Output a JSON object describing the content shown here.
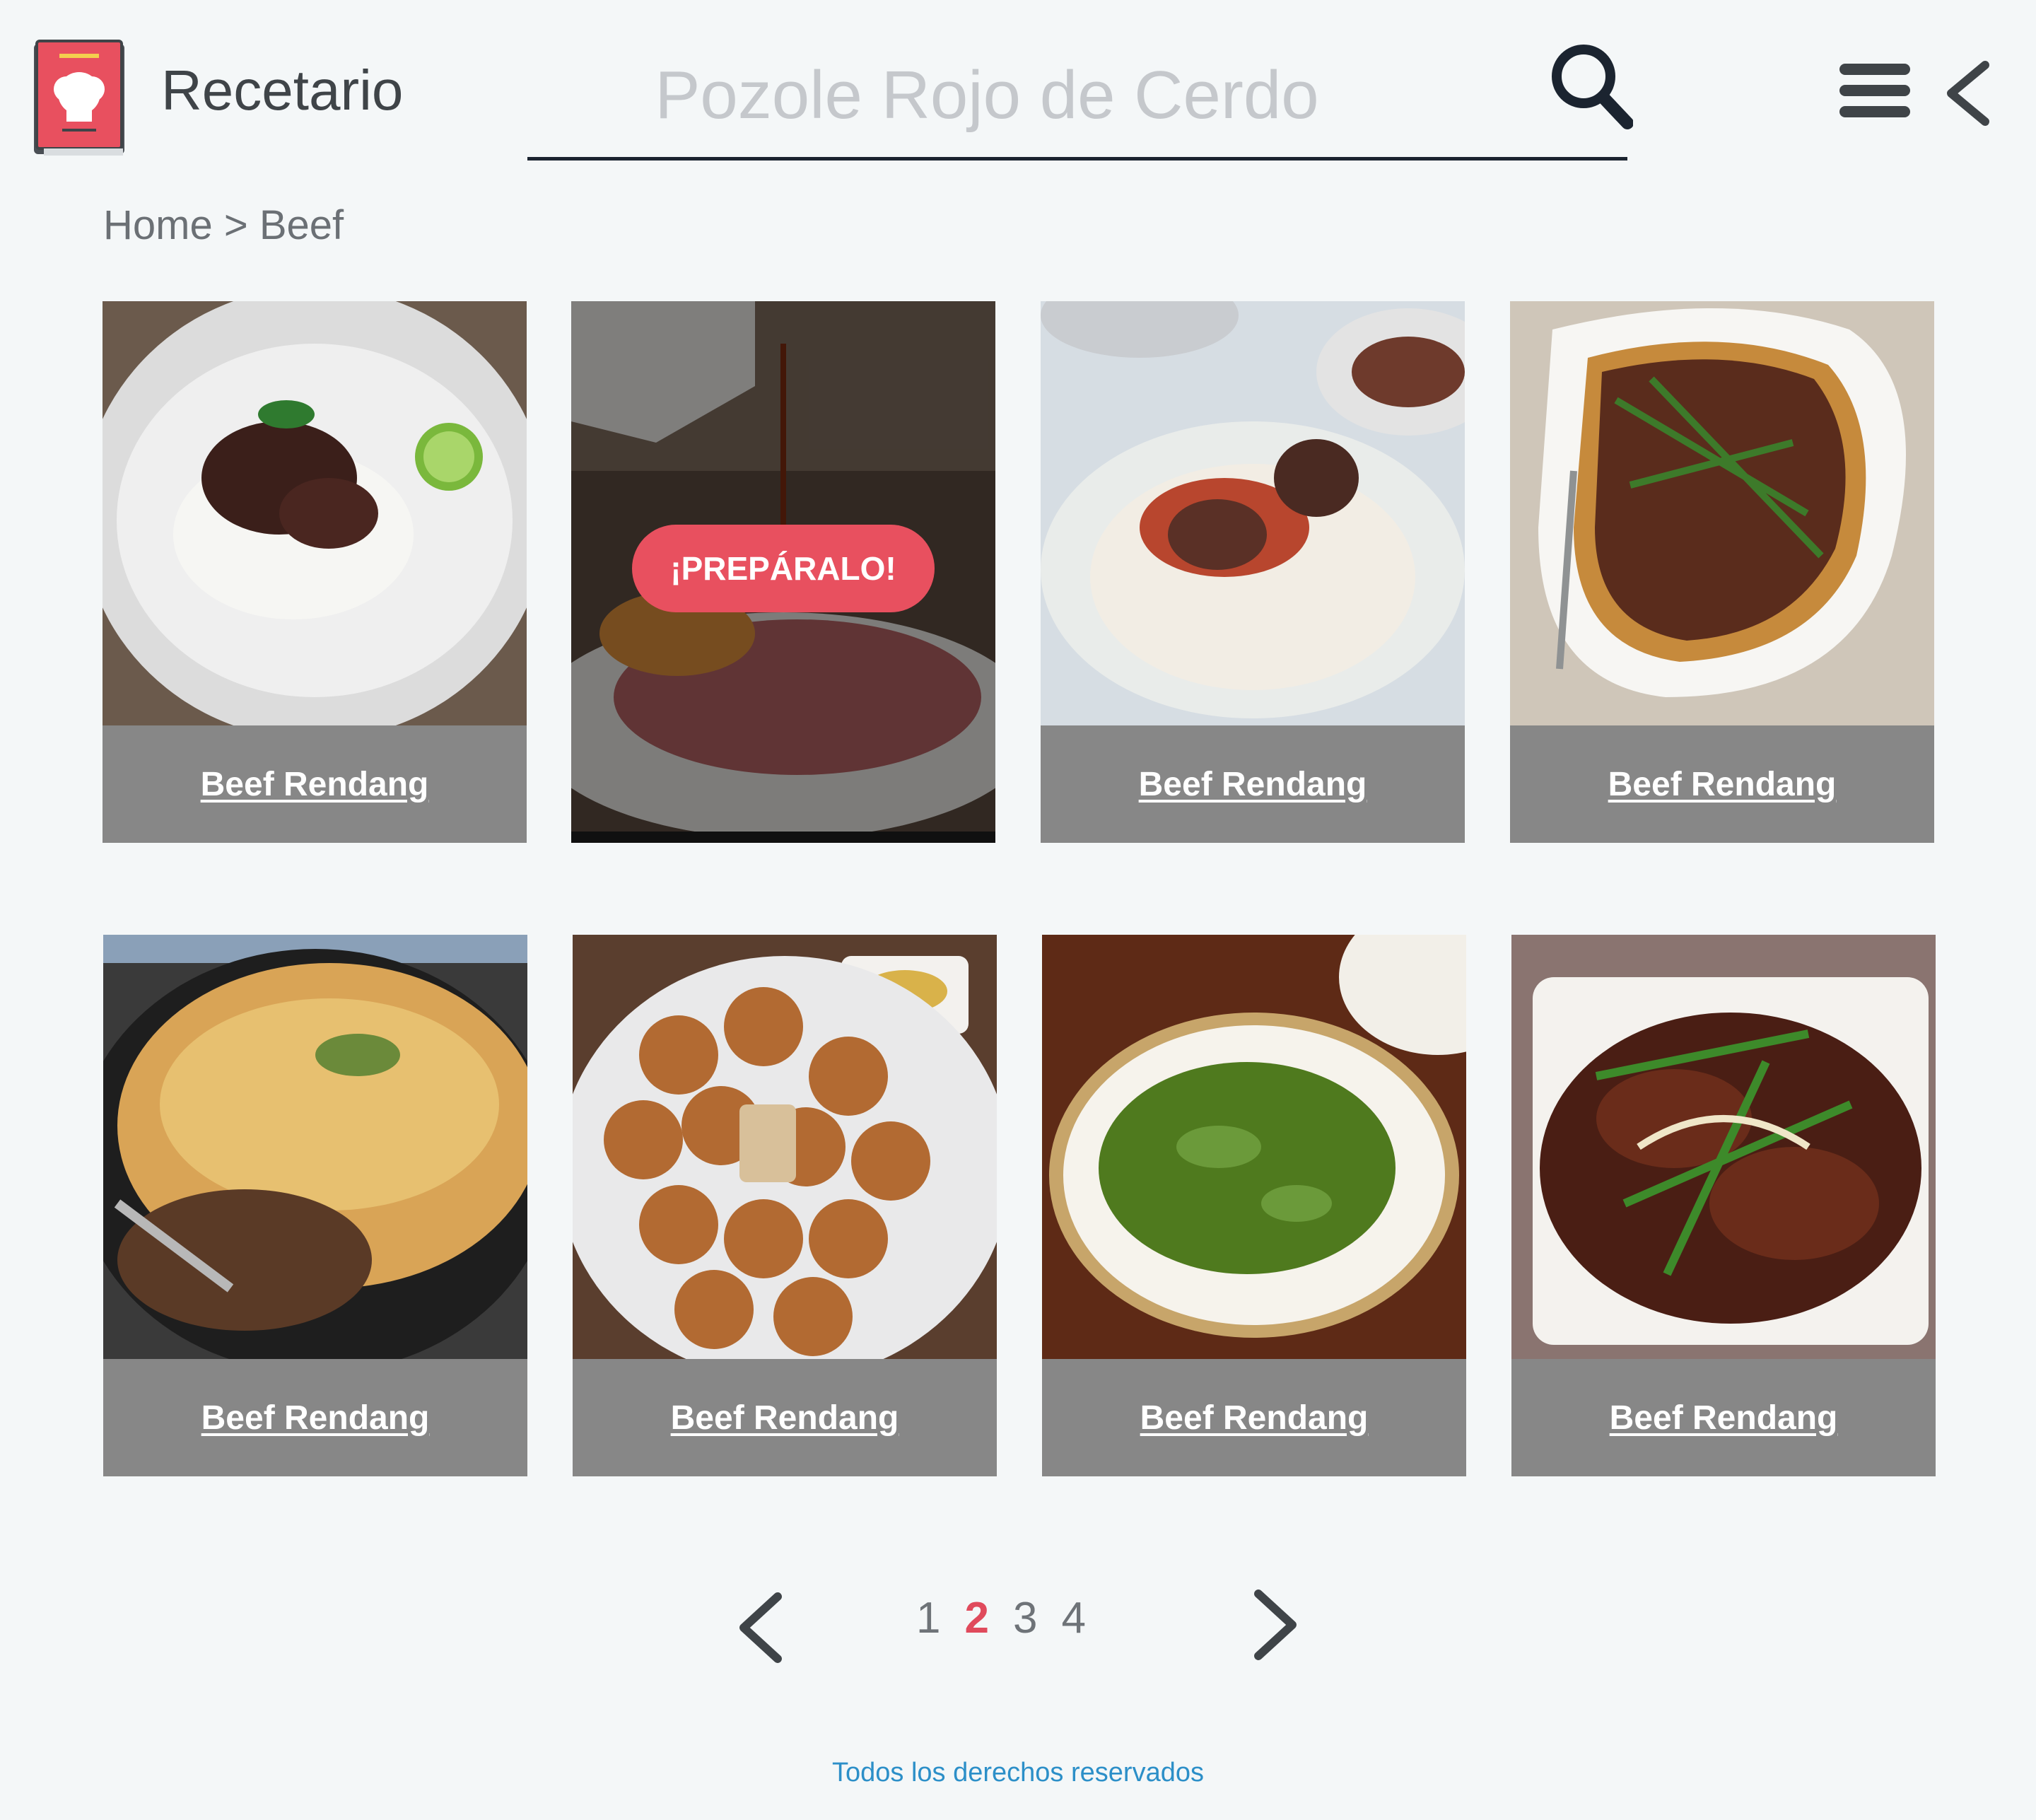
{
  "header": {
    "app_title": "Recetario",
    "search_placeholder": "Pozole Rojo de Cerdo"
  },
  "breadcrumb": {
    "home": "Home",
    "separator": " > ",
    "current": "Beef"
  },
  "cards": [
    {
      "title": "Beef Rendang"
    },
    {
      "title": "",
      "hover_button": "¡PREPÁRALO!"
    },
    {
      "title": "Beef Rendang"
    },
    {
      "title": "Beef Rendang"
    },
    {
      "title": "Beef Rendang"
    },
    {
      "title": "Beef Rendang"
    },
    {
      "title": "Beef Rendang"
    },
    {
      "title": "Beef Rendang"
    }
  ],
  "pagination": {
    "pages": [
      "1",
      "2",
      "3",
      "4"
    ],
    "current": "2"
  },
  "footer": {
    "text": "Todos los derechos reservados"
  },
  "colors": {
    "accent": "#e8505f",
    "caption_bg": "#878787",
    "footer_link": "#2c8fc8"
  }
}
